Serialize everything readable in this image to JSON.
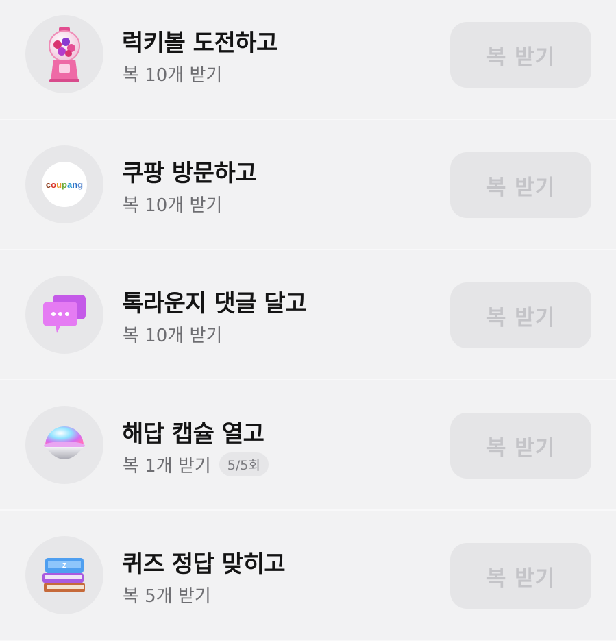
{
  "missions": [
    {
      "id": "lucky-ball",
      "title": "럭키볼 도전하고",
      "reward": "복 10개 받기",
      "badge": "",
      "button": "복 받기",
      "icon": "gumball-machine-icon"
    },
    {
      "id": "coupang",
      "title": "쿠팡 방문하고",
      "reward": "복 10개 받기",
      "badge": "",
      "button": "복 받기",
      "icon": "coupang-logo-icon",
      "logo_text": "coupang"
    },
    {
      "id": "talk-lounge",
      "title": "톡라운지 댓글 달고",
      "reward": "복 10개 받기",
      "badge": "",
      "button": "복 받기",
      "icon": "chat-bubbles-icon"
    },
    {
      "id": "answer-capsule",
      "title": "해답 캡슐 열고",
      "reward": "복 1개 받기",
      "badge": "5/5회",
      "button": "복 받기",
      "icon": "capsule-icon"
    },
    {
      "id": "quiz",
      "title": "퀴즈 정답 맞히고",
      "reward": "복 5개 받기",
      "badge": "",
      "button": "복 받기",
      "icon": "books-icon"
    }
  ],
  "colors": {
    "background": "#f2f2f3",
    "button_bg": "#e5e5e7",
    "button_text": "#c4c4c8",
    "title": "#141414",
    "subtitle": "#6e6e72"
  }
}
